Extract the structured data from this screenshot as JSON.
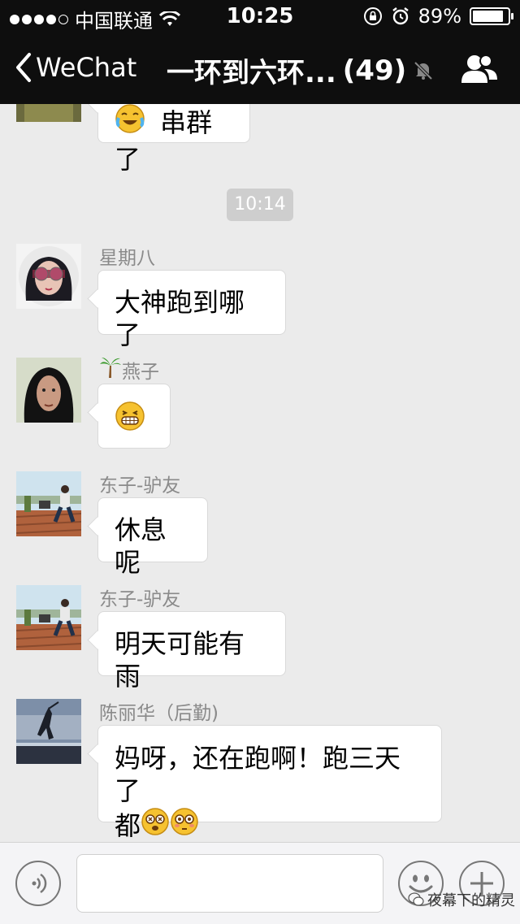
{
  "status_bar": {
    "carrier": "中国联通",
    "time": "10:25",
    "battery_text": "89%",
    "battery_level": 0.89
  },
  "nav": {
    "back_label": "WeChat",
    "title": "一环到六环...",
    "member_count": "(49)"
  },
  "messages": [
    {
      "sender": "",
      "text": "串群了",
      "emoji_before": "tears-of-joy-emoji"
    },
    {
      "timestamp": "10:14"
    },
    {
      "sender": "星期八",
      "text": "大神跑到哪了"
    },
    {
      "sender": "燕子",
      "sender_icon": "palm-tree-emoji",
      "text": "",
      "emoji": "grin-emoji"
    },
    {
      "sender": "东子-驴友",
      "text": "休息呢"
    },
    {
      "sender": "东子-驴友",
      "text": "明天可能有雨"
    },
    {
      "sender": "陈丽华（后勤)",
      "text_line1": "妈呀，还在跑啊！跑三天了",
      "text_line2": "都"
    }
  ],
  "watermark": "夜幕下的精灵",
  "colors": {
    "nav_bg": "#0e0e0e",
    "chat_bg": "#ebebeb",
    "bubble_bg": "#ffffff",
    "sender_text": "#8a8a8a",
    "timestamp_bg": "#cecece"
  }
}
